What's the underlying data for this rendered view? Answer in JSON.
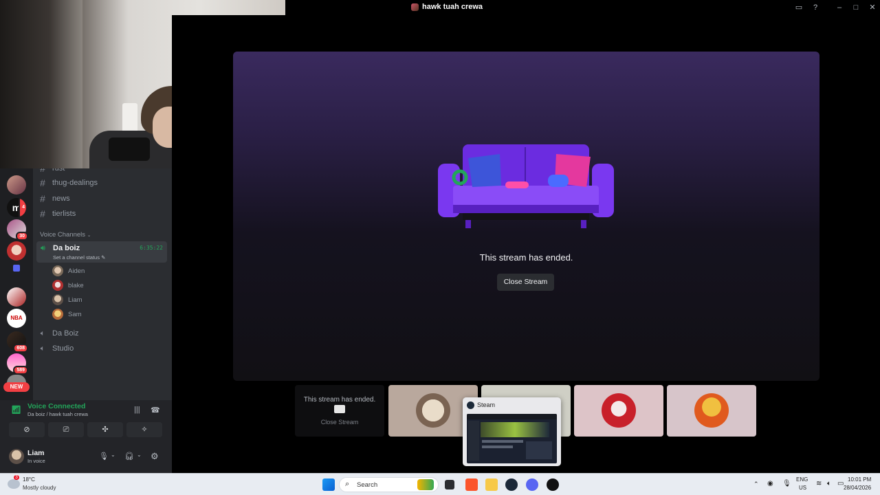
{
  "window": {
    "title": "hawk tuah crewa"
  },
  "server_rail": {
    "badges": [
      "4",
      "30",
      "608",
      "589"
    ],
    "new_label": "NEW"
  },
  "channels": {
    "partial_top": "rust",
    "text": [
      "thug-dealings",
      "news",
      "tierlists"
    ],
    "voice_category": "Voice Channels",
    "active_voice": {
      "name": "Da boiz",
      "timer": "6:35:22",
      "status_placeholder": "Set a channel status",
      "members": [
        "Aiden",
        "blake",
        "Liam",
        "Sam"
      ]
    },
    "other_voice": [
      "Da Boiz",
      "Studio"
    ]
  },
  "voice_panel": {
    "status": "Voice Connected",
    "location": "Da boiz / hawk tuah crewa"
  },
  "user_panel": {
    "name": "Liam",
    "status": "In voice"
  },
  "stage": {
    "message": "This stream has ended.",
    "close_button": "Close Stream"
  },
  "tiles": {
    "ended_message": "This stream has ended.",
    "ended_button": "Close Stream"
  },
  "steam_preview": {
    "label": "Steam"
  },
  "taskbar": {
    "weather_temp": "18°C",
    "weather_desc": "Mostly cloudy",
    "weather_badge": "3",
    "search_label": "Search",
    "lang_1": "ENG",
    "lang_2": "US",
    "time": "10:01 PM",
    "date": "28/04/2026"
  },
  "colors": {
    "accent_green": "#23a55a",
    "danger_red": "#f23f43",
    "sidebar_bg": "#2b2d31",
    "rail_bg": "#1e1f22"
  }
}
